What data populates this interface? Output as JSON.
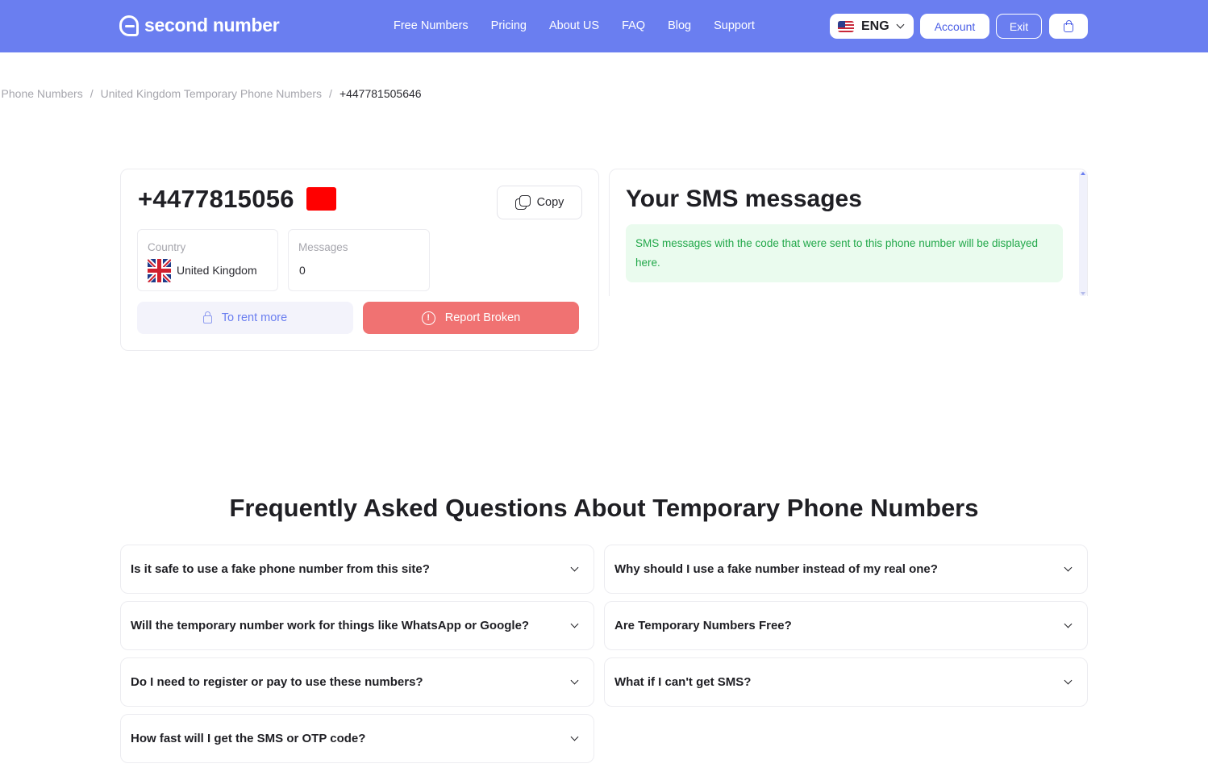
{
  "header": {
    "logo_text": "second number",
    "nav": [
      "Free Numbers",
      "Pricing",
      "About US",
      "FAQ",
      "Blog",
      "Support"
    ],
    "language": "ENG",
    "account_label": "Account",
    "exit_label": "Exit",
    "brand_color": "#6a7ef0"
  },
  "breadcrumb": {
    "items": [
      "ry Phone Numbers",
      "United Kingdom Temporary Phone Numbers"
    ],
    "separator": "/",
    "current": "+447781505646"
  },
  "number_card": {
    "phone": "+4477815056",
    "copy_label": "Copy",
    "country_label": "Country",
    "country_value": "United Kingdom",
    "messages_label": "Messages",
    "messages_value": "0",
    "rent_label": "To rent more",
    "report_label": "Report Broken",
    "report_color": "#f07272"
  },
  "sms": {
    "title": "Your SMS messages",
    "note": "SMS messages with the code that were sent to this phone number will be displayed here."
  },
  "faq": {
    "title": "Frequently Asked Questions About Temporary Phone Numbers",
    "left": [
      "Is it safe to use a fake phone number from this site?",
      "Will the temporary number work for things like WhatsApp or Google?",
      "Do I need to register or pay to use these numbers?",
      "How fast will I get the SMS or OTP code?"
    ],
    "right": [
      "Why should I use a fake number instead of my real one?",
      "Are Temporary Numbers Free?",
      "What if I can't get SMS?"
    ]
  }
}
